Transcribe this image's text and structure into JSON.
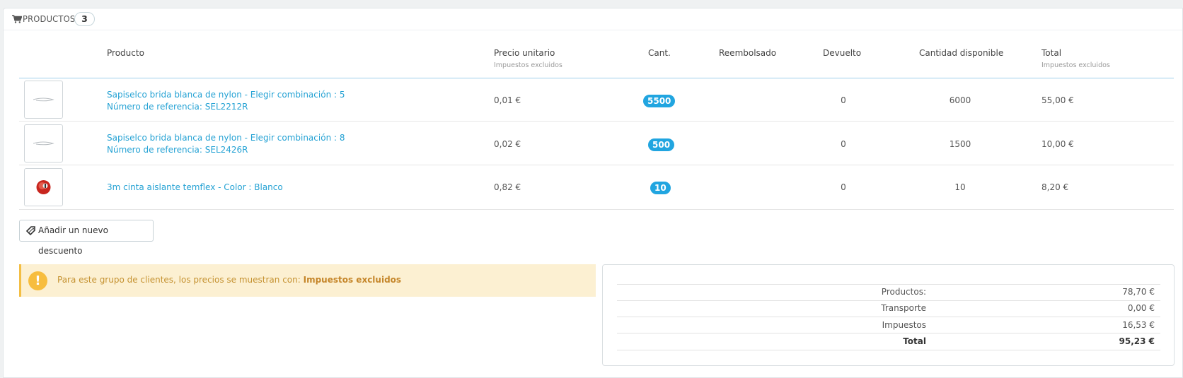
{
  "panel": {
    "title": "PRODUCTOS",
    "count": "3"
  },
  "table": {
    "headers": {
      "product": "Producto",
      "unit_price": "Precio unitario",
      "unit_price_sub": "Impuestos excluidos",
      "qty": "Cant.",
      "refunded": "Reembolsado",
      "returned": "Devuelto",
      "available": "Cantidad disponible",
      "total": "Total",
      "total_sub": "Impuestos excluidos"
    },
    "rows": [
      {
        "name": "Sapiselco brida blanca de nylon - Elegir combinación : 5",
        "reference": "Número de referencia: SEL2212R",
        "unit_price": "0,01 €",
        "qty": "5500",
        "returned": "0",
        "available": "6000",
        "total": "55,00 €",
        "thumb_icon": "cable-tie-icon"
      },
      {
        "name": "Sapiselco brida blanca de nylon - Elegir combinación : 8",
        "reference": "Número de referencia: SEL2426R",
        "unit_price": "0,02 €",
        "qty": "500",
        "returned": "0",
        "available": "1500",
        "total": "10,00 €",
        "thumb_icon": "cable-tie-icon"
      },
      {
        "name": "3m cinta aislante temflex - Color : Blanco",
        "reference": "",
        "unit_price": "0,82 €",
        "qty": "10",
        "returned": "0",
        "available": "10",
        "total": "8,20 €",
        "thumb_icon": "tape-roll-icon"
      }
    ]
  },
  "discount_button": "Añadir un nuevo descuento",
  "alert": {
    "text": "Para este grupo de clientes, los precios se muestran con:",
    "emphasis": "Impuestos excluidos",
    "icon": "!"
  },
  "totals": {
    "products_label": "Productos:",
    "products_value": "78,70 €",
    "shipping_label": "Transporte",
    "shipping_value": "0,00 €",
    "taxes_label": "Impuestos",
    "taxes_value": "16,53 €",
    "total_label": "Total",
    "total_value": "95,23 €"
  },
  "colors": {
    "link": "#25a2d4",
    "badge": "#21a5e0",
    "alert_bg": "#fcf0d2",
    "alert_border": "#f3be44"
  }
}
